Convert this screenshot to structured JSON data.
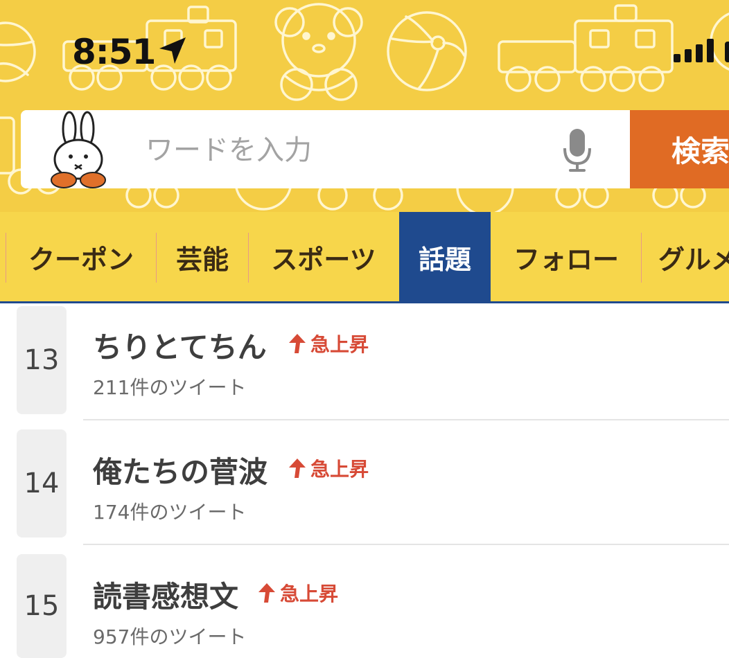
{
  "status_bar": {
    "time": "8:51",
    "location_icon": "location-arrow-icon",
    "signal_icon": "cellular-signal-icon"
  },
  "search": {
    "placeholder": "ワードを入力",
    "value": "",
    "button_label": "検索",
    "mic_icon": "microphone-icon",
    "mascot": "rabbit-mascot"
  },
  "tabs": [
    {
      "label": "クーポン",
      "active": false
    },
    {
      "label": "芸能",
      "active": false
    },
    {
      "label": "スポーツ",
      "active": false
    },
    {
      "label": "話題",
      "active": true
    },
    {
      "label": "フォロー",
      "active": false
    },
    {
      "label": "グルメ",
      "active": false
    }
  ],
  "trends": [
    {
      "rank": "13",
      "title": "ちりとてちん",
      "badge": "急上昇",
      "count": "211件のツイート"
    },
    {
      "rank": "14",
      "title": "俺たちの菅波",
      "badge": "急上昇",
      "count": "174件のツイート"
    },
    {
      "rank": "15",
      "title": "読書感想文",
      "badge": "急上昇",
      "count": "957件のツイート"
    }
  ],
  "colors": {
    "header_bg": "#f4cd45",
    "tab_bg": "#f7d64b",
    "active_tab": "#1f4a8e",
    "search_button": "#e06b24",
    "rise_badge": "#d74a36"
  }
}
